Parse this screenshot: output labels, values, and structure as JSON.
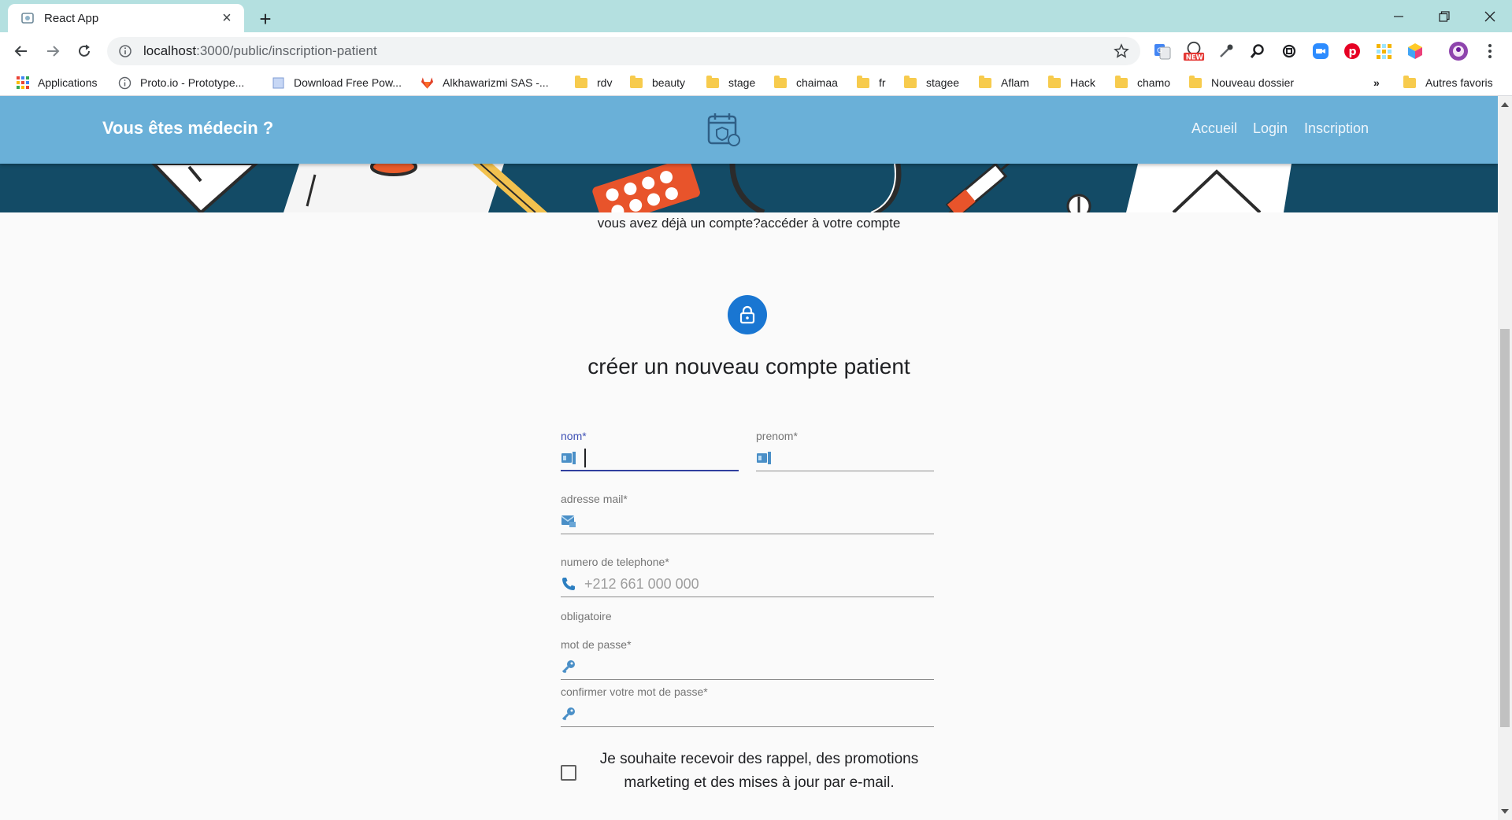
{
  "browser": {
    "tab_title": "React App",
    "url_host": "localhost",
    "url_rest": ":3000/public/inscription-patient",
    "bookmarks": [
      {
        "label": "Applications",
        "icon": "apps-grid-icon"
      },
      {
        "label": "Proto.io - Prototype...",
        "icon": "info-circle-icon"
      },
      {
        "label": "Download Free Pow...",
        "icon": "page-icon"
      },
      {
        "label": "Alkhawarizmi SAS -...",
        "icon": "gitlab-icon"
      },
      {
        "label": "rdv",
        "icon": "folder-icon"
      },
      {
        "label": "beauty",
        "icon": "folder-icon"
      },
      {
        "label": "stage",
        "icon": "folder-icon"
      },
      {
        "label": "chaimaa",
        "icon": "folder-icon"
      },
      {
        "label": "fr",
        "icon": "folder-icon"
      },
      {
        "label": "stagee",
        "icon": "folder-icon"
      },
      {
        "label": "Aflam",
        "icon": "folder-icon"
      },
      {
        "label": "Hack",
        "icon": "folder-icon"
      },
      {
        "label": "chamo",
        "icon": "folder-icon"
      },
      {
        "label": "Nouveau dossier",
        "icon": "folder-icon"
      }
    ],
    "more_bookmarks": "»",
    "other_bookmarks": "Autres favoris",
    "extension_badge": "NEW"
  },
  "appbar": {
    "brand": "Vous êtes médecin ?",
    "nav": [
      "Accueil",
      "Login",
      "Inscription"
    ]
  },
  "page": {
    "signin_link": "vous avez déjà un compte?accéder à votre compte",
    "title": "créer un nouveau compte patient"
  },
  "form": {
    "nom_label": "nom",
    "prenom_label": "prenom",
    "email_label": "adresse mail",
    "phone_label": "numero de telephone",
    "phone_placeholder": "+212 661 000 000",
    "phone_helper": "obligatoire",
    "password_label": "mot de passe",
    "confirm_label": "confirmer votre mot de passe",
    "required_mark": "*",
    "consent_text": "Je souhaite recevoir des rappel, des promotions marketing et des mises à jour par e-mail."
  },
  "colors": {
    "tabstrip": "#b4e0e0",
    "appbar": "#6ab0d8",
    "hero": "#134b66",
    "lock_avatar": "#1976d2",
    "focus": "#3f51b5",
    "icon": "#4a8fc7"
  }
}
